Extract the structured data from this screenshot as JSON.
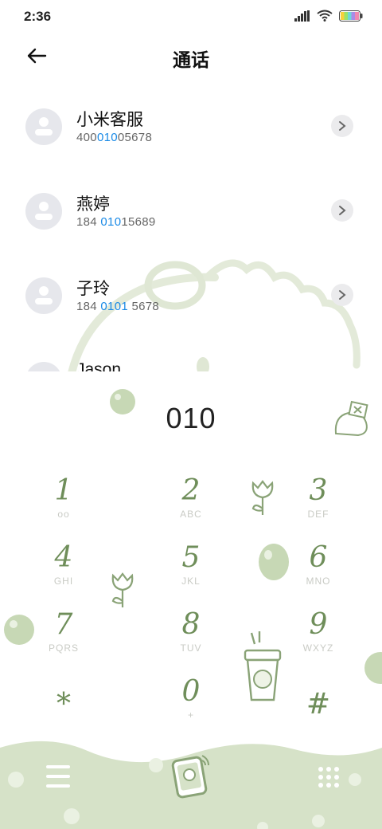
{
  "status": {
    "time": "2:36"
  },
  "header": {
    "title": "通话"
  },
  "contacts": [
    {
      "name": "小米客服",
      "number_parts": [
        "400",
        "010",
        "05678"
      ]
    },
    {
      "name": "燕婷",
      "number_parts": [
        "184 ",
        "010",
        "15689"
      ]
    },
    {
      "name": "子玲",
      "number_parts": [
        "184 ",
        "0101",
        " 5678"
      ]
    },
    {
      "name": "Jason",
      "number_parts": [
        "",
        "",
        ""
      ]
    }
  ],
  "dialer": {
    "input": "010",
    "keys": [
      {
        "digit": "1",
        "letters": "ᴏᴏ"
      },
      {
        "digit": "2",
        "letters": "ABC"
      },
      {
        "digit": "3",
        "letters": "DEF"
      },
      {
        "digit": "4",
        "letters": "GHI"
      },
      {
        "digit": "5",
        "letters": "JKL"
      },
      {
        "digit": "6",
        "letters": "MNO"
      },
      {
        "digit": "7",
        "letters": "PQRS"
      },
      {
        "digit": "8",
        "letters": "TUV"
      },
      {
        "digit": "9",
        "letters": "WXYZ"
      },
      {
        "digit": "*",
        "letters": ""
      },
      {
        "digit": "0",
        "letters": "+"
      },
      {
        "digit": "#",
        "letters": ""
      }
    ]
  },
  "colors": {
    "accent": "#6f8e5a",
    "highlight": "#1a8ae6",
    "wave": "#d6e2c8"
  },
  "icons": {
    "back": "arrow-left-icon",
    "menu": "menu-icon",
    "keypad": "keypad-icon",
    "call": "phone-call-icon"
  }
}
